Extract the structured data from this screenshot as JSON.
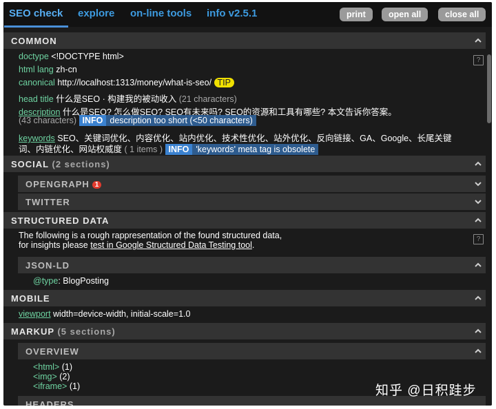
{
  "tabs": [
    {
      "label": "SEO check"
    },
    {
      "label": "explore"
    },
    {
      "label": "on-line tools"
    },
    {
      "label": "info v2.5.1"
    }
  ],
  "buttons": {
    "print": "print",
    "open_all": "open all",
    "close_all": "close all"
  },
  "common": {
    "title": "COMMON",
    "doctype": {
      "key": "doctype",
      "value": "<!DOCTYPE html>"
    },
    "html_lang": {
      "key": "html lang",
      "value": "zh-cn"
    },
    "canonical": {
      "key": "canonical",
      "value": "http://localhost:1313/money/what-is-seo/",
      "tip": "TIP"
    },
    "head_title": {
      "key": "head title",
      "value": "什么是SEO · 构建我的被动收入",
      "count": "(21 characters)"
    },
    "description": {
      "key": "description",
      "value": "什么是SEO? 怎么做SEO? SEO有未来吗? SEO的资源和工具有哪些? 本文告诉你答案。",
      "count": "(43 characters)",
      "info_label": "INFO",
      "info_text": "description too short (<50 characters)"
    },
    "keywords": {
      "key": "keywords",
      "value_line1": "SEO、关键词优化、内容优化、站内优化、技术性优化、站外优化、反向链接、GA、Google、长尾关键",
      "value_line2": "词、内链优化、网站权威度",
      "count": "( 1 items )",
      "info_label": "INFO",
      "info_text": "'keywords' meta tag is obsolete"
    }
  },
  "social": {
    "title": "SOCIAL",
    "count": "(2 sections)",
    "opengraph": {
      "title": "OPENGRAPH",
      "badge": "1"
    },
    "twitter": {
      "title": "TWITTER"
    }
  },
  "structured": {
    "title": "STRUCTURED DATA",
    "text1": "The following is a rough rappresentation of the found structured data,",
    "text2_prefix": "for insights please",
    "text2_link": "test in Google Structured Data Testing tool",
    "text2_suffix": ".",
    "jsonld": {
      "title": "JSON-LD",
      "type_key": "@type",
      "type_value": ": BlogPosting"
    }
  },
  "mobile": {
    "title": "MOBILE",
    "viewport_key": "viewport",
    "viewport_value": "width=device-width, initial-scale=1.0"
  },
  "markup": {
    "title": "MARKUP",
    "count": "(5 sections)",
    "overview": {
      "title": "OVERVIEW",
      "items": [
        {
          "tag": "<html>",
          "count": "(1)"
        },
        {
          "tag": "<img>",
          "count": "(2)"
        },
        {
          "tag": "<iframe>",
          "count": "(1)"
        }
      ]
    },
    "headers": {
      "title": "HEADERS"
    }
  },
  "help_icon": "?",
  "watermark": "知乎 @日积跬步"
}
